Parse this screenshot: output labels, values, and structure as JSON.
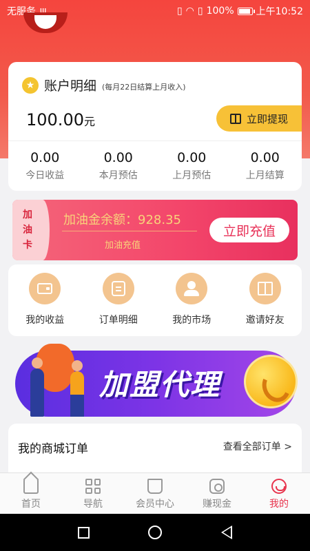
{
  "status_bar": {
    "carrier": "无服务",
    "usb_icon": "ψ",
    "battery": "100%",
    "time": "上午10:52"
  },
  "account": {
    "title": "账户明细",
    "subtitle": "(每月22日结算上月收入)",
    "balance": "100.00",
    "balance_unit": "元",
    "withdraw_label": "立即提现",
    "stats": [
      {
        "value": "0.00",
        "label": "今日收益"
      },
      {
        "value": "0.00",
        "label": "本月预估"
      },
      {
        "value": "0.00",
        "label": "上月预估"
      },
      {
        "value": "0.00",
        "label": "上月结算"
      }
    ]
  },
  "fuel_card": {
    "tag_line1": "加",
    "tag_line2": "油",
    "tag_line3": "卡",
    "balance_text": "加油金余额：928.35",
    "sub_label": "加油充值",
    "recharge_label": "立即充值"
  },
  "quick_menu": [
    {
      "label": "我的收益",
      "icon": "wallet-icon"
    },
    {
      "label": "订单明细",
      "icon": "document-icon"
    },
    {
      "label": "我的市场",
      "icon": "people-icon"
    },
    {
      "label": "邀请好友",
      "icon": "gift-icon"
    }
  ],
  "banner": {
    "text": "加盟代理"
  },
  "orders": {
    "title": "我的商城订单",
    "view_all": "查看全部订单 >"
  },
  "tab_bar": [
    {
      "label": "首页",
      "icon": "home-icon",
      "active": false
    },
    {
      "label": "导航",
      "icon": "grid-icon",
      "active": false
    },
    {
      "label": "会员中心",
      "icon": "crown-icon",
      "active": false
    },
    {
      "label": "赚现金",
      "icon": "coin-icon",
      "active": false
    },
    {
      "label": "我的",
      "icon": "profile-icon",
      "active": true
    }
  ],
  "colors": {
    "header_red": "#f5453e",
    "accent_yellow": "#f7c137",
    "fuel_pink": "#f3456a",
    "active_tab": "#e8344d",
    "banner_purple": "#7d34e6"
  }
}
